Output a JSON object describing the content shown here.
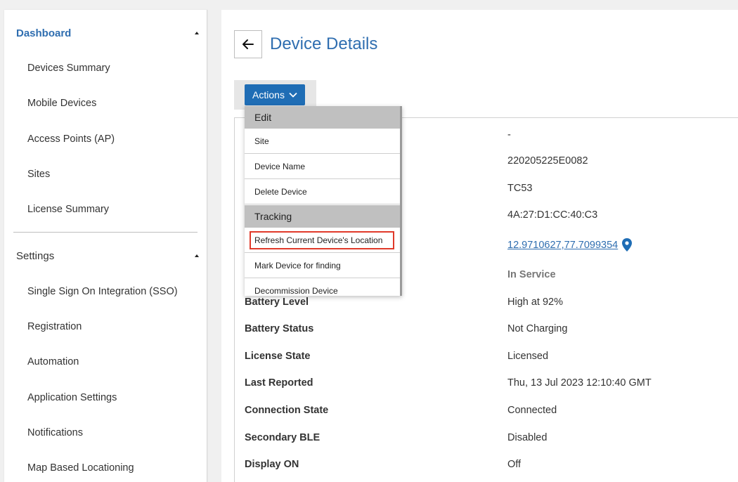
{
  "sidebar": {
    "sections": [
      {
        "label": "Dashboard",
        "items": [
          "Devices Summary",
          "Mobile Devices",
          "Access Points (AP)",
          "Sites",
          "License Summary"
        ]
      },
      {
        "label": "Settings",
        "items": [
          "Single Sign On Integration (SSO)",
          "Registration",
          "Automation",
          "Application Settings",
          "Notifications",
          "Map Based Locationing"
        ]
      }
    ]
  },
  "header": {
    "title": "Device Details",
    "back_icon": "arrow-left-icon",
    "actions_label": "Actions"
  },
  "actions_menu": {
    "groups": [
      {
        "label": "Edit",
        "items": [
          "Site",
          "Device Name",
          "Delete Device"
        ]
      },
      {
        "label": "Tracking",
        "items": [
          "Refresh Current Device's Location",
          "Mark Device for finding",
          "Decommission Device"
        ]
      }
    ],
    "highlighted_item": "Refresh Current Device's Location",
    "highlight_color": "#e03a2a"
  },
  "details": {
    "hidden_values": [
      "-",
      "220205225E0082",
      "TC53",
      "4A:27:D1:CC:40:C3"
    ],
    "location": "12.9710627,77.7099354",
    "location_icon": "map-pin-icon",
    "status": "In Service",
    "rows": [
      {
        "label": "Battery Level",
        "value": "High at 92%"
      },
      {
        "label": "Battery Status",
        "value": "Not Charging"
      },
      {
        "label": "License State",
        "value": "Licensed"
      },
      {
        "label": "Last Reported",
        "value": "Thu, 13 Jul 2023 12:10:40 GMT"
      },
      {
        "label": "Connection State",
        "value": "Connected"
      },
      {
        "label": "Secondary BLE",
        "value": "Disabled"
      },
      {
        "label": "Display ON",
        "value": "Off"
      }
    ]
  },
  "colors": {
    "accent": "#2f6eb0",
    "button": "#1f6db5",
    "group_bg": "#c0c0c0"
  }
}
